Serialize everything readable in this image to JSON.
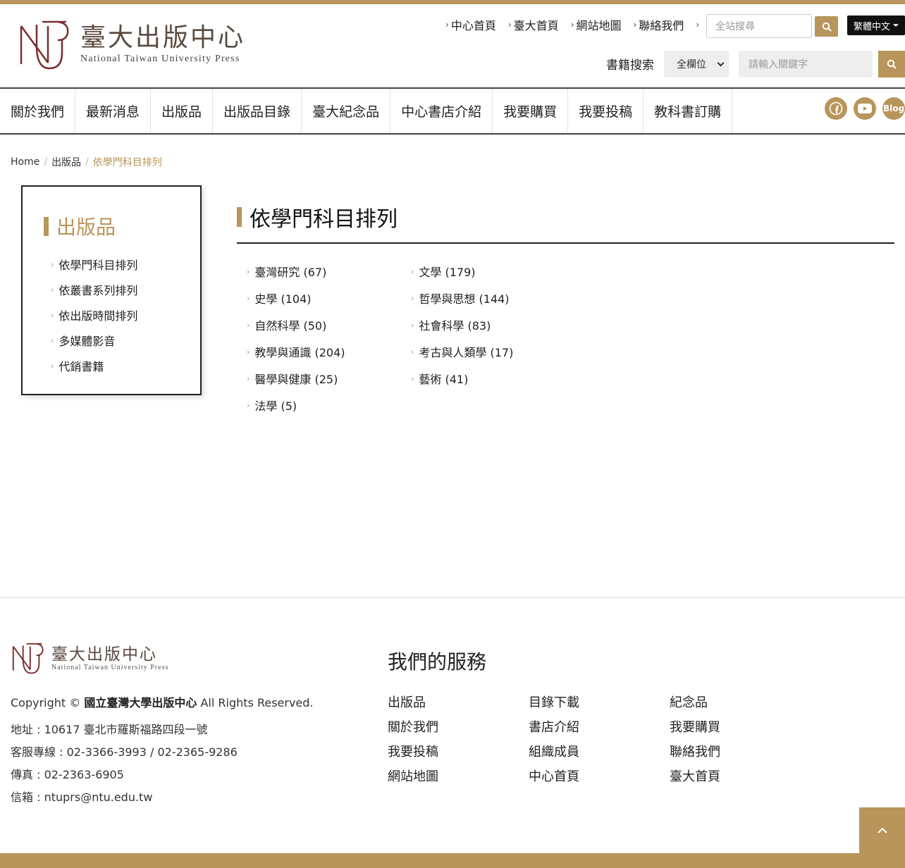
{
  "header": {
    "logo_cn": "臺大出版中心",
    "logo_en": "National Taiwan University Press",
    "top_links": [
      "中心首頁",
      "臺大首頁",
      "網站地圖",
      "聯絡我們"
    ],
    "site_search_placeholder": "全站搜尋",
    "language": "繁體中文",
    "book_search_label": "書籍搜索",
    "book_search_field": "全欄位",
    "book_search_placeholder": "請輸入關鍵字"
  },
  "nav": [
    "關於我們",
    "最新消息",
    "出版品",
    "出版品目錄",
    "臺大紀念品",
    "中心書店介紹",
    "我要購買",
    "我要投稿",
    "教科書訂購"
  ],
  "social": {
    "blog": "Blog"
  },
  "breadcrumb": {
    "home": "Home",
    "section": "出版品",
    "current": "依學門科目排列"
  },
  "sidebar": {
    "title": "出版品",
    "items": [
      "依學門科目排列",
      "依叢書系列排列",
      "依出版時間排列",
      "多媒體影音",
      "代銷書籍"
    ]
  },
  "main": {
    "title": "依學門科目排列",
    "categories_left": [
      "臺灣研究 (67)",
      "史學 (104)",
      "自然科學 (50)",
      "教學與通識 (204)",
      "醫學與健康 (25)",
      "法學 (5)"
    ],
    "categories_right": [
      "文學 (179)",
      "哲學與思想 (144)",
      "社會科學 (83)",
      "考古與人類學 (17)",
      "藝術 (41)"
    ]
  },
  "footer": {
    "logo_cn": "臺大出版中心",
    "logo_en": "National Taiwan University Press",
    "copyright_prefix": "Copyright ©",
    "copyright_org": "國立臺灣大學出版中心",
    "copyright_suffix": "All Rights Reserved.",
    "address": "地址 : 10617 臺北市羅斯福路四段一號",
    "phone": "客服專線 : 02-3366-3993 / 02-2365-9286",
    "fax": "傳真 : 02-2363-6905",
    "email": "信箱 : ntuprs@ntu.edu.tw",
    "services_title": "我們的服務",
    "services_col1": [
      "出版品",
      "關於我們",
      "我要投稿",
      "網站地圖"
    ],
    "services_col2": [
      "目錄下載",
      "書店介紹",
      "組織成員",
      "中心首頁"
    ],
    "services_col3": [
      "紀念品",
      "我要購買",
      "聯絡我們",
      "臺大首頁"
    ]
  },
  "colors": {
    "accent": "#b8955a",
    "logo": "#7a2e2e"
  }
}
